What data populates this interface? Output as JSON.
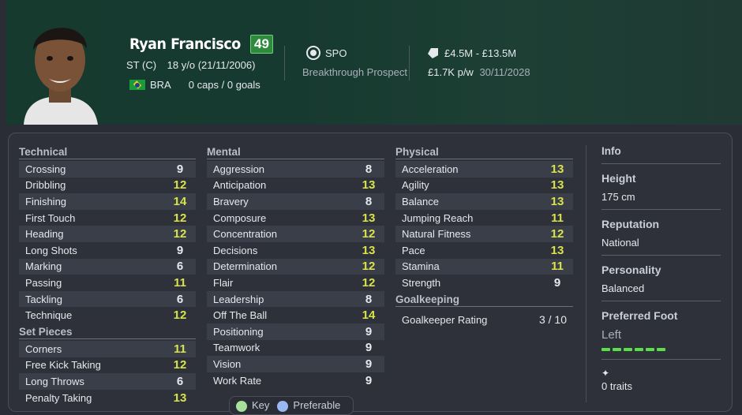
{
  "header": {
    "name": "Ryan Francisco",
    "ovr": "49",
    "position": "ST (C)",
    "age": "18 y/o (21/11/2006)",
    "nation": "BRA",
    "caps": "0 caps / 0 goals",
    "club": "SPO",
    "prospect": "Breakthrough Prospect",
    "value": "£4.5M - £13.5M",
    "wage": "£1.7K p/w",
    "contract": "30/11/2028"
  },
  "technical": {
    "title": "Technical",
    "rows": [
      {
        "label": "Crossing",
        "value": "9"
      },
      {
        "label": "Dribbling",
        "value": "12"
      },
      {
        "label": "Finishing",
        "value": "14"
      },
      {
        "label": "First Touch",
        "value": "12"
      },
      {
        "label": "Heading",
        "value": "12"
      },
      {
        "label": "Long Shots",
        "value": "9"
      },
      {
        "label": "Marking",
        "value": "6"
      },
      {
        "label": "Passing",
        "value": "11"
      },
      {
        "label": "Tackling",
        "value": "6"
      },
      {
        "label": "Technique",
        "value": "12"
      }
    ]
  },
  "set_pieces": {
    "title": "Set Pieces",
    "rows": [
      {
        "label": "Corners",
        "value": "11"
      },
      {
        "label": "Free Kick Taking",
        "value": "12"
      },
      {
        "label": "Long Throws",
        "value": "6"
      },
      {
        "label": "Penalty Taking",
        "value": "13"
      }
    ]
  },
  "mental": {
    "title": "Mental",
    "rows": [
      {
        "label": "Aggression",
        "value": "8"
      },
      {
        "label": "Anticipation",
        "value": "13"
      },
      {
        "label": "Bravery",
        "value": "8"
      },
      {
        "label": "Composure",
        "value": "13"
      },
      {
        "label": "Concentration",
        "value": "12"
      },
      {
        "label": "Decisions",
        "value": "13"
      },
      {
        "label": "Determination",
        "value": "12"
      },
      {
        "label": "Flair",
        "value": "12"
      },
      {
        "label": "Leadership",
        "value": "8"
      },
      {
        "label": "Off The Ball",
        "value": "14"
      },
      {
        "label": "Positioning",
        "value": "9"
      },
      {
        "label": "Teamwork",
        "value": "9"
      },
      {
        "label": "Vision",
        "value": "9"
      },
      {
        "label": "Work Rate",
        "value": "9"
      }
    ]
  },
  "physical": {
    "title": "Physical",
    "rows": [
      {
        "label": "Acceleration",
        "value": "13"
      },
      {
        "label": "Agility",
        "value": "13"
      },
      {
        "label": "Balance",
        "value": "13"
      },
      {
        "label": "Jumping Reach",
        "value": "11"
      },
      {
        "label": "Natural Fitness",
        "value": "12"
      },
      {
        "label": "Pace",
        "value": "13"
      },
      {
        "label": "Stamina",
        "value": "11"
      },
      {
        "label": "Strength",
        "value": "9"
      }
    ]
  },
  "goalkeeping": {
    "title": "Goalkeeping",
    "label": "Goalkeeper Rating",
    "value": "3 / 10"
  },
  "info": {
    "title": "Info",
    "height_label": "Height",
    "height": "175 cm",
    "reputation_label": "Reputation",
    "reputation": "National",
    "personality_label": "Personality",
    "personality": "Balanced",
    "foot_label": "Preferred Foot",
    "foot": "Left",
    "traits": "0 traits"
  },
  "legend": {
    "key": "Key",
    "preferable": "Preferable"
  },
  "colors": {
    "high": "#d9e34a",
    "normal": "#e6e8ee",
    "key": "#a8e29a",
    "preferable": "#9ab8f2",
    "foot_bar": "#5adf4a"
  }
}
